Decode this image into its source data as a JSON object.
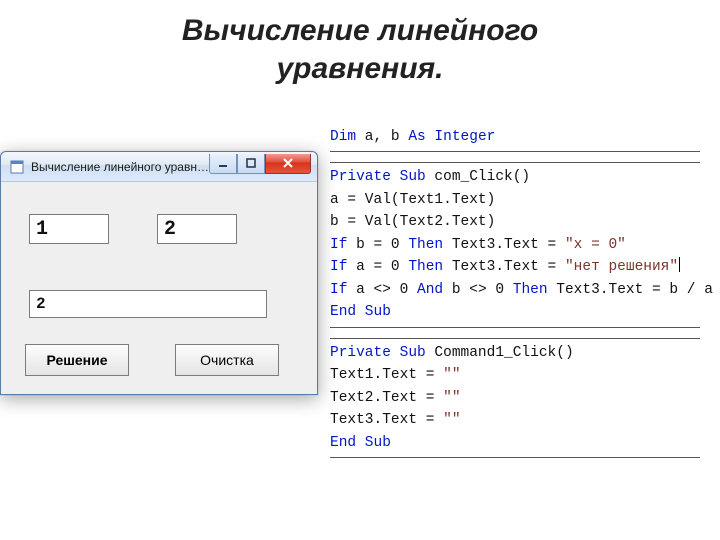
{
  "slide": {
    "title_line1": "Вычисление линейного",
    "title_line2": "уравнения."
  },
  "window": {
    "title": "Вычисление линейного уравнения.",
    "input_a": "1",
    "input_b": "2",
    "result": "2",
    "btn_solve": "Решение",
    "btn_clear": "Очистка"
  },
  "code": {
    "decl": "Dim a, b As Integer",
    "sub1": {
      "header": "Private Sub com_Click()",
      "lines": [
        "a = Val(Text1.Text)",
        "b = Val(Text2.Text)",
        "If b = 0 Then Text3.Text = \"x = 0\"",
        "If a = 0 Then Text3.Text = \"нет решения\"",
        "If a <> 0 And b <> 0 Then Text3.Text = b / a"
      ],
      "end": "End Sub"
    },
    "sub2": {
      "header": "Private Sub Command1_Click()",
      "lines": [
        "Text1.Text = \"\"",
        "Text2.Text = \"\"",
        "Text3.Text = \"\""
      ],
      "end": "End Sub"
    }
  }
}
